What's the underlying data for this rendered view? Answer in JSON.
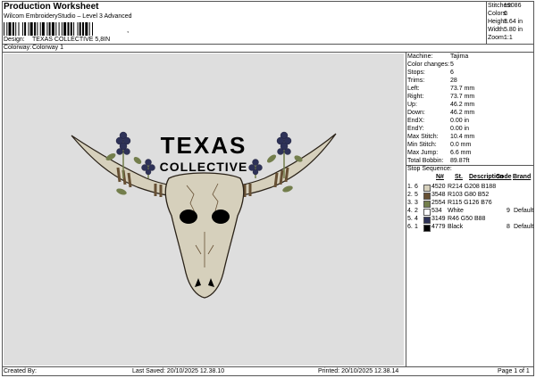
{
  "header": {
    "title": "Production Worksheet",
    "subtitle": "Wilcom EmbroideryStudio – Level 3 Advanced",
    "barcode_text": ",",
    "design_label": "Design:",
    "design_value": "TEXAS COLLECTIVE 5,8IN",
    "colorway_label": "Colorway:",
    "colorway_value": "Colorway 1"
  },
  "stats": [
    {
      "label": "Stitches:",
      "value": "19086"
    },
    {
      "label": "Colors:",
      "value": "6"
    },
    {
      "label": "Height:",
      "value": "3.64 in"
    },
    {
      "label": "Width:",
      "value": "5.80 in"
    },
    {
      "label": "Zoom:",
      "value": "1:1"
    }
  ],
  "machine": [
    {
      "label": "Machine:",
      "value": "Tajima"
    },
    {
      "label": "Color changes:",
      "value": "5"
    },
    {
      "label": "Stops:",
      "value": "6"
    },
    {
      "label": "Trims:",
      "value": "28"
    },
    {
      "label": "Left:",
      "value": "73.7 mm"
    },
    {
      "label": "Right:",
      "value": "73.7 mm"
    },
    {
      "label": "Up:",
      "value": "46.2 mm"
    },
    {
      "label": "Down:",
      "value": "46.2 mm"
    },
    {
      "label": "EndX:",
      "value": "0.00 in"
    },
    {
      "label": "EndY:",
      "value": "0.00 in"
    },
    {
      "label": "Max Stitch:",
      "value": "10.4 mm"
    },
    {
      "label": "Min Stitch:",
      "value": "0.0 mm"
    },
    {
      "label": "Max Jump:",
      "value": "6.6 mm"
    },
    {
      "label": "Total Bobbin:",
      "value": "89.87ft"
    }
  ],
  "stop_sequence": {
    "title": "Stop Sequence:",
    "columns": {
      "n": "N#",
      "st": "St.",
      "description": "Description",
      "code": "Code",
      "brand": "Brand"
    },
    "rows": [
      {
        "stop": "1.",
        "n": "6",
        "color": "#d6d0bc",
        "st": "4520",
        "description": "R214 G208 B188",
        "code": "",
        "brand": ""
      },
      {
        "stop": "2.",
        "n": "5",
        "color": "#675034",
        "st": "3548",
        "description": "R103 G80 B52",
        "code": "",
        "brand": ""
      },
      {
        "stop": "3.",
        "n": "3",
        "color": "#737e4c",
        "st": "2554",
        "description": "R115 G126 B76",
        "code": "",
        "brand": ""
      },
      {
        "stop": "4.",
        "n": "2",
        "color": "#ffffff",
        "st": "534",
        "description": "White",
        "code": "9",
        "brand": "Default"
      },
      {
        "stop": "5.",
        "n": "4",
        "color": "#2e3258",
        "st": "3149",
        "description": "R46 G50 B88",
        "code": "",
        "brand": ""
      },
      {
        "stop": "6.",
        "n": "1",
        "color": "#000000",
        "st": "4779",
        "description": "Black",
        "code": "8",
        "brand": "Default"
      }
    ]
  },
  "design_art": {
    "line1": "TEXAS",
    "line2": "COLLECTIVE",
    "colors": {
      "bone": "#d6d0bc",
      "brown": "#675034",
      "green": "#737e4c",
      "navy": "#2e3258",
      "black": "#000000",
      "canvas": "#dedede"
    }
  },
  "footer": {
    "created_by": "Created By:",
    "last_saved": "Last Saved: 20/10/2025 12.38.10",
    "printed": "Printed: 20/10/2025 12.38.14",
    "page": "Page 1 of 1"
  }
}
